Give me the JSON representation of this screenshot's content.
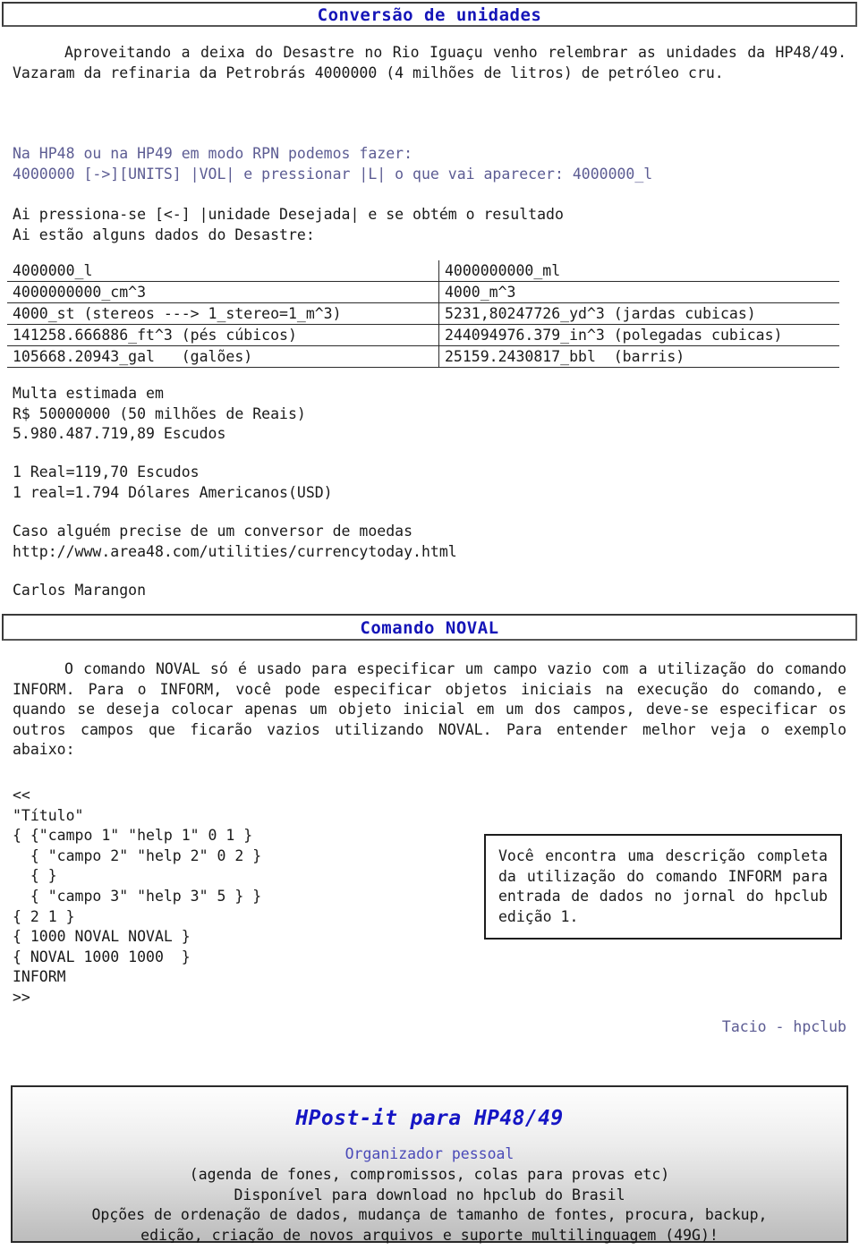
{
  "sections": {
    "header1": {
      "title": "Conversão de unidades"
    },
    "header2": {
      "title": "Comando NOVAL"
    }
  },
  "intro": {
    "paragraph": "Aproveitando a deixa do Desastre no Rio Iguaçu venho relembrar as unidades da HP48/49. Vazaram da refinaria da Petrobrás 4000000 (4 milhões de litros) de petróleo cru."
  },
  "rpn": {
    "lines": "Na HP48 ou na HP49 em modo RPN podemos fazer:\n4000000 [->][UNITS] |VOL| e pressionar |L| o que vai aparecer: 4000000_l"
  },
  "obtem": {
    "lines": "Ai pressiona-se [<-] |unidade Desejada| e se obtém o resultado\nAi estão alguns dados do Desastre:"
  },
  "conversion_table": {
    "rows": [
      {
        "left": "4000000_l",
        "right": "4000000000_ml"
      },
      {
        "left": "4000000000_cm^3",
        "right": "4000_m^3"
      },
      {
        "left": "4000_st (stereos ---> 1_stereo=1_m^3)",
        "right": "5231,80247726_yd^3 (jardas cubicas)"
      },
      {
        "left": "141258.666886_ft^3 (pés cúbicos)",
        "right": "244094976.379_in^3 (polegadas cubicas)"
      },
      {
        "left": "105668.20943_gal   (galões)",
        "right": "25159.2430817_bbl  (barris)"
      }
    ]
  },
  "multa": {
    "lines": "Multa estimada em\nR$ 50000000 (50 milhões de Reais)\n5.980.487.719,89 Escudos"
  },
  "cambio": {
    "lines": "1 Real=119,70 Escudos\n1 real=1.794 Dólares Americanos(USD)"
  },
  "conversor": {
    "lines": "Caso alguém precise de um conversor de moedas\nhttp://www.area48.com/utilities/currencytoday.html"
  },
  "autor": {
    "name": "Carlos Marangon"
  },
  "noval": {
    "paragraph": "O comando NOVAL só é usado para especificar um campo vazio com a utilização do comando INFORM. Para o INFORM, você pode especificar objetos iniciais na execução do comando, e quando se deseja colocar apenas um objeto inicial em um dos campos, deve-se especificar os outros campos que ficarão vazios utilizando NOVAL. Para entender melhor veja o exemplo abaixo:"
  },
  "code_example": {
    "lines": "<<\n\"Título\"\n{ {\"campo 1\" \"help 1\" 0 1 }\n  { \"campo 2\" \"help 2\" 0 2 }\n  { }\n  { \"campo 3\" \"help 3\" 5 } }\n{ 2 1 }\n{ 1000 NOVAL NOVAL }\n{ NOVAL 1000 1000  }\nINFORM\n>>"
  },
  "side_note": {
    "text": "Você encontra uma descrição completa da utilização do comando INFORM para entrada de dados no jornal do hpclub edição 1."
  },
  "credit": {
    "text": "Tacio - hpclub"
  },
  "advertisement": {
    "title": "HPost-it para HP48/49",
    "subtitle": "Organizador pessoal",
    "line1": "(agenda de fones, compromissos, colas para provas etc)",
    "line2": "Disponível para download no hpclub do Brasil",
    "line3": "Opções de ordenação de dados, mudança de tamanho de fontes, procura, backup,",
    "line4": "edição, criação de novos arquivos e suporte multilinguagem (49G)!"
  },
  "colors": {
    "heading_blue": "#1515b8",
    "accent_slate": "#5c5c93",
    "ad_title_blue": "#1515c4",
    "ad_sub_blue": "#4a4ab8",
    "body_text": "#1a1a1a",
    "rule": "#2b2b2b"
  }
}
